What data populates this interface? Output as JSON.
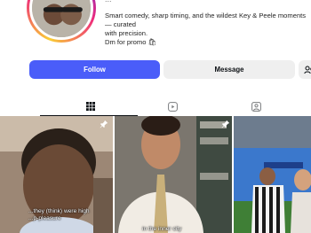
{
  "profile": {
    "stats_text": "...",
    "bio_line_1": "Smart comedy, sharp timing, and the wildest Key & Peele moments — curated",
    "bio_line_2": "with precision.",
    "bio_promo": "Dm for promo 🛍"
  },
  "actions": {
    "follow_label": "Follow",
    "message_label": "Message"
  },
  "tabs": [
    {
      "name": "posts",
      "icon": "grid-icon",
      "active": true
    },
    {
      "name": "reels",
      "icon": "reels-icon",
      "active": false
    },
    {
      "name": "tagged",
      "icon": "tagged-icon",
      "active": false
    }
  ],
  "posts": [
    {
      "caption": "...they (think) were high\n...p-pleasure",
      "pinned": true
    },
    {
      "caption": "in the inner city",
      "pinned": true
    },
    {
      "caption": "",
      "pinned": false
    }
  ],
  "colors": {
    "follow_bg": "#4a5df9",
    "message_bg": "#efefef",
    "text_primary": "#0c1014",
    "text_secondary": "#737373"
  }
}
